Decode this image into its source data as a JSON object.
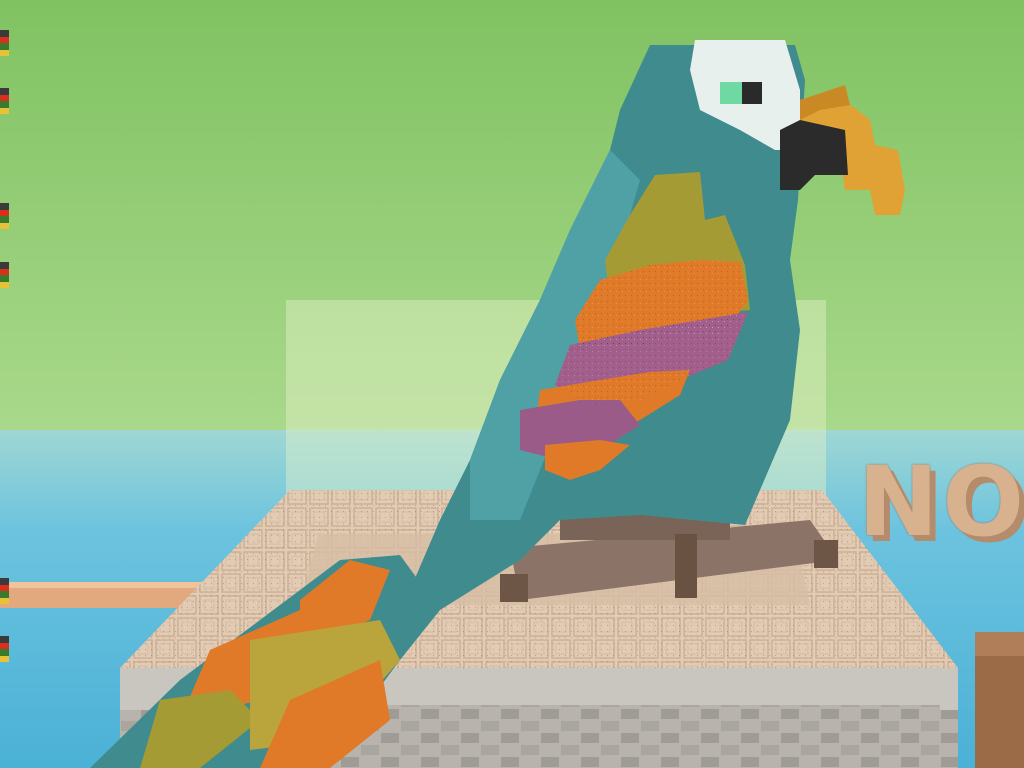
{
  "scene": {
    "subject": "parrot-statue",
    "sign_text": "NO",
    "colors": {
      "sky_top": "#86c46a",
      "sky_bottom": "#d6efb7",
      "water": "#5fbcd9",
      "platform": "#e4cdb4",
      "parrot_body": "#3f8b8e",
      "parrot_body_light": "#4fa1a5",
      "beak": "#e0a235",
      "beak_dark": "#2b2b2b",
      "eye_patch": "#e8f0ee",
      "eye": "#6fd9a4",
      "wing_orange": "#e07a28",
      "wing_olive": "#a59b34",
      "wing_magenta": "#a25f8c",
      "perch": "#8a7468"
    }
  },
  "hud": {
    "left_markers": [
      {
        "icon": "hotbar-marker-icon"
      },
      {
        "icon": "hotbar-marker-icon"
      },
      {
        "icon": "hotbar-marker-icon"
      },
      {
        "icon": "hotbar-marker-icon"
      },
      {
        "icon": "hotbar-marker-icon"
      },
      {
        "icon": "hotbar-marker-icon"
      }
    ]
  }
}
